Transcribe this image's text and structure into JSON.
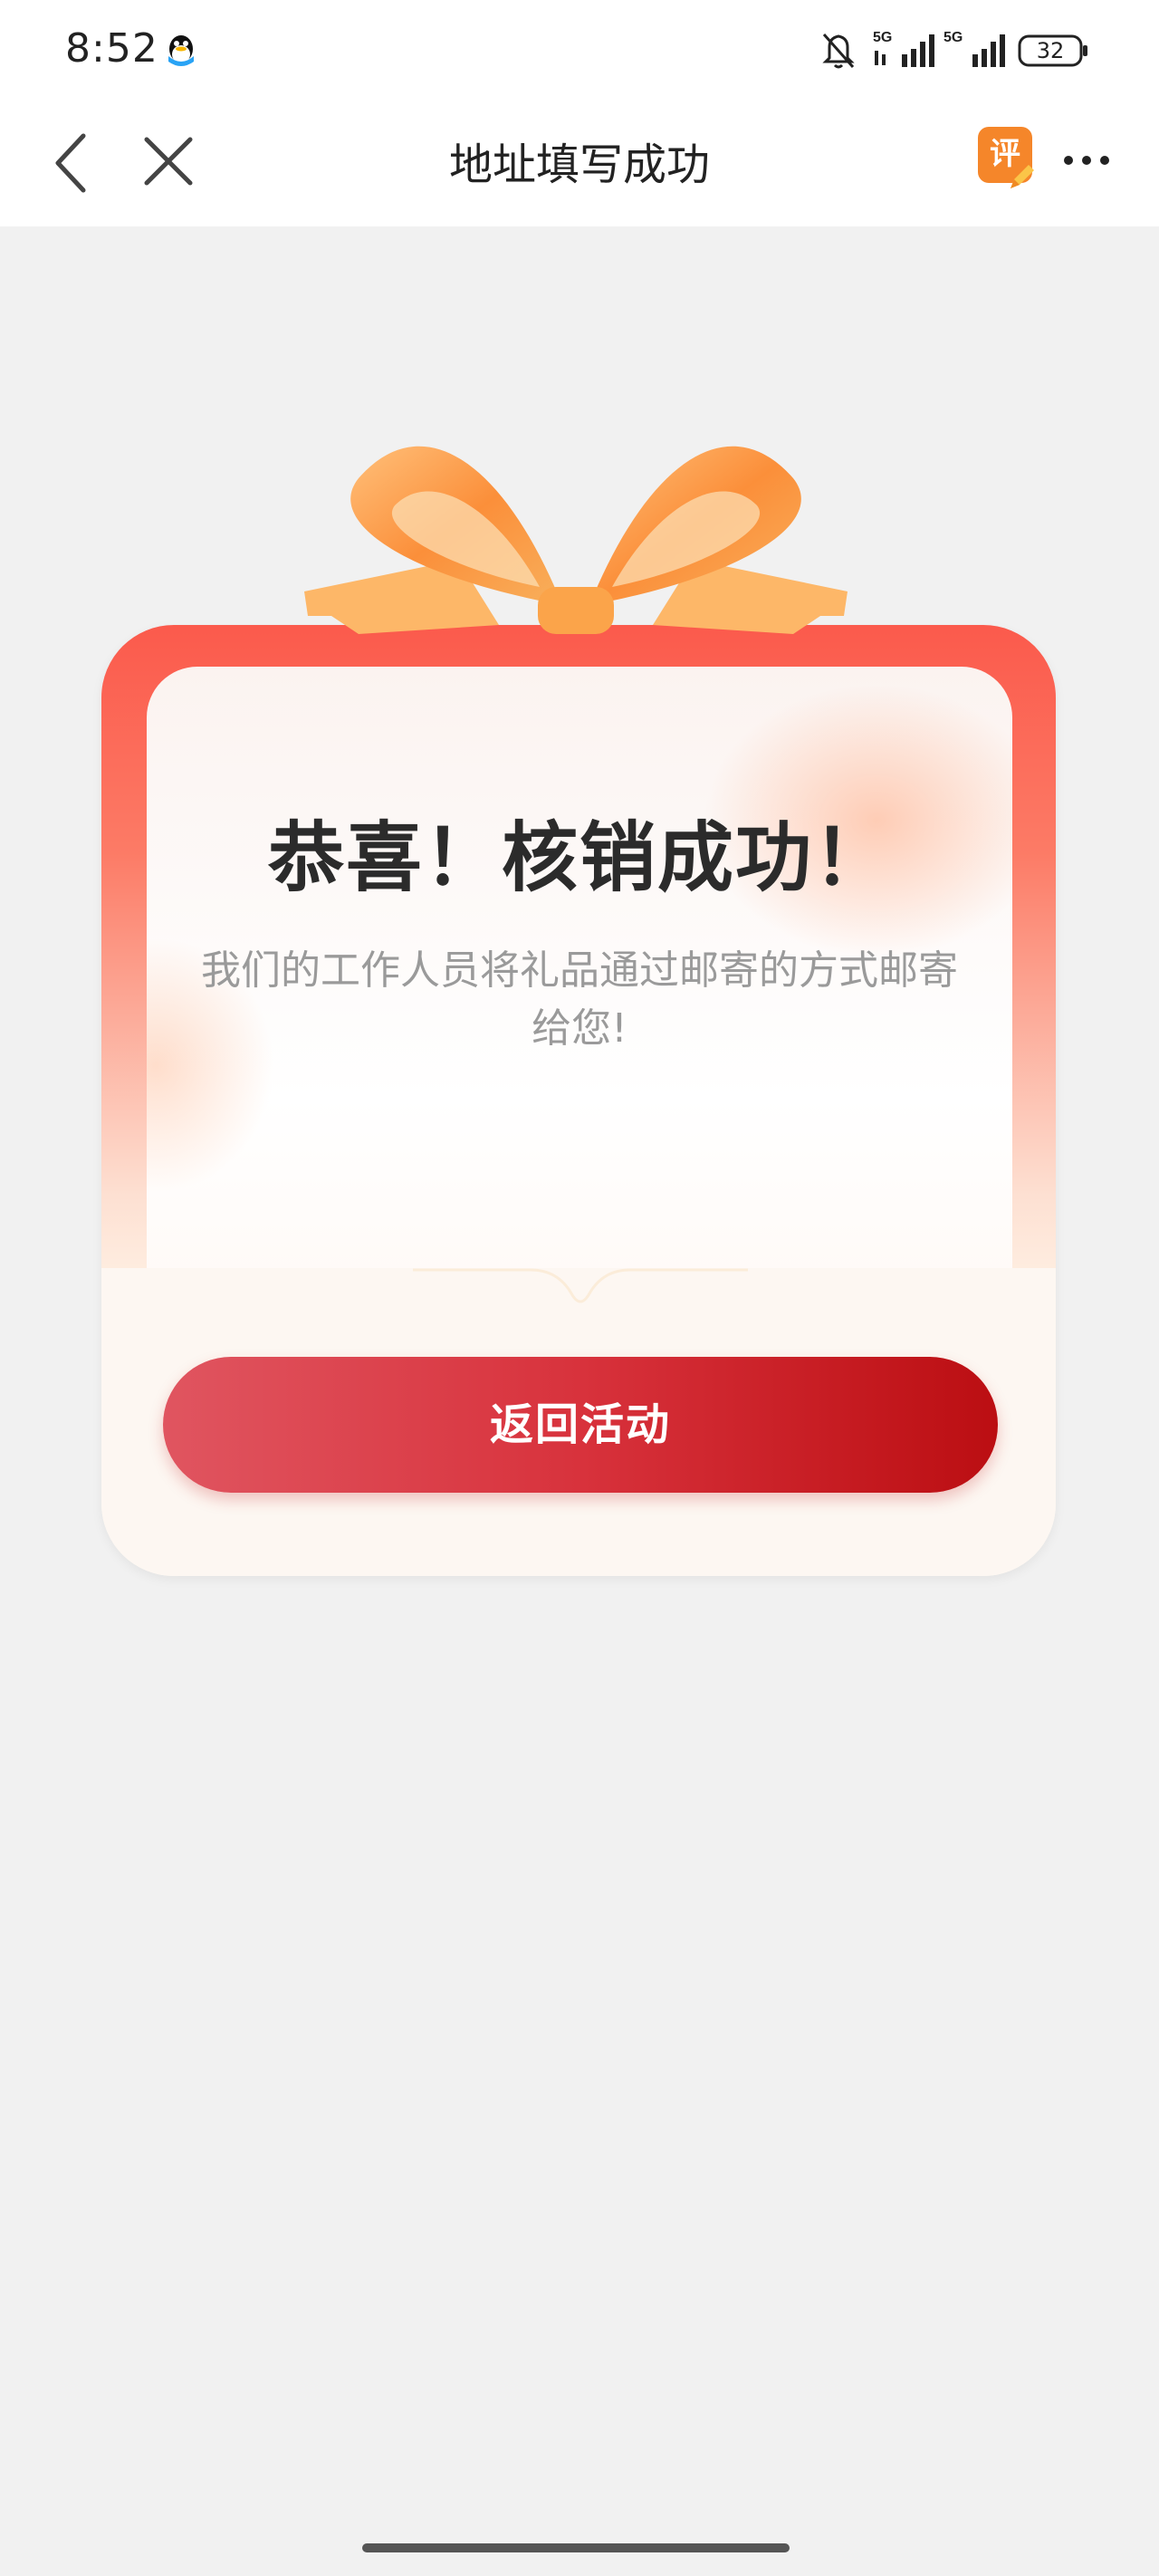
{
  "status_bar": {
    "time": "8:52",
    "battery": "32",
    "network_1": "5G",
    "network_2": "5G",
    "icons": [
      "qq-icon",
      "mute-icon",
      "signal-icon",
      "signal-icon",
      "battery-icon"
    ]
  },
  "nav": {
    "title": "地址填写成功",
    "review_label": "评",
    "icons": [
      "back-icon",
      "close-icon",
      "review-icon",
      "more-icon"
    ]
  },
  "card": {
    "title": "恭喜！核销成功！",
    "description": "我们的工作人员将礼品通过邮寄的方式邮寄给您!",
    "button_label": "返回活动"
  },
  "colors": {
    "button_start": "#e05560",
    "button_end": "#bb0e12",
    "card_top": "#fb5a4c",
    "bow_orange": "#fb9a3c",
    "page_bg": "#f1f1f1"
  }
}
